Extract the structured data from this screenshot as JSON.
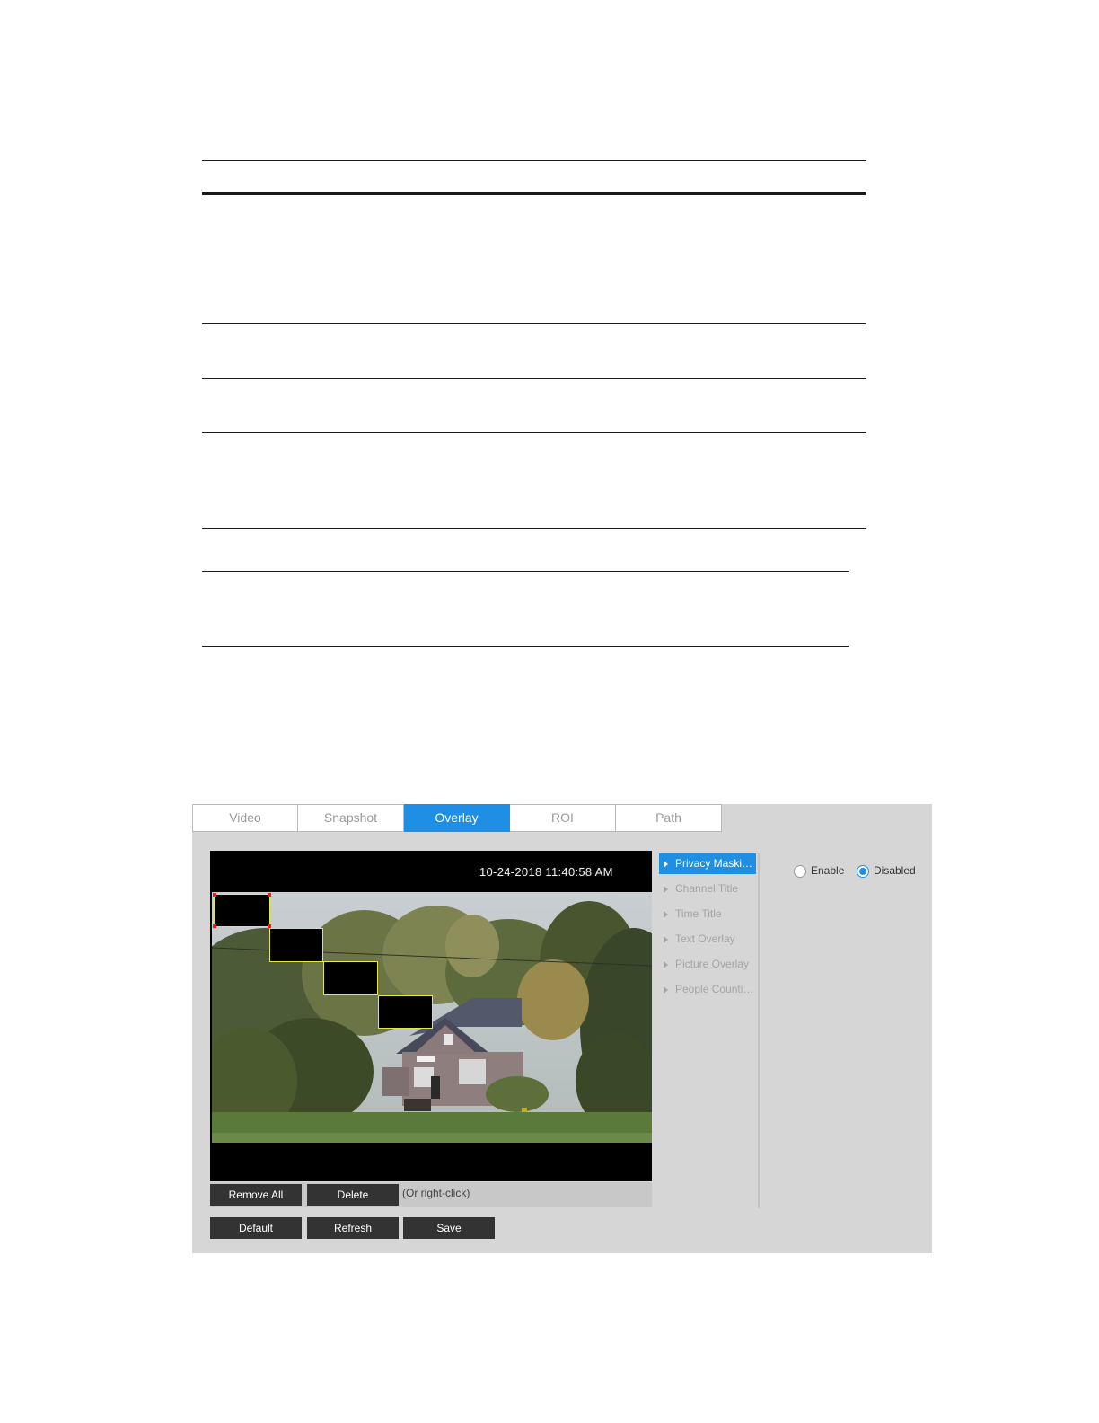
{
  "tabs": [
    {
      "label": "Video"
    },
    {
      "label": "Snapshot"
    },
    {
      "label": "Overlay"
    },
    {
      "label": "ROI"
    },
    {
      "label": "Path"
    }
  ],
  "active_tab": "Overlay",
  "video": {
    "osd_time": "10-24-2018 11:40:58 AM",
    "mask_count": 4
  },
  "edit_bar": {
    "remove_all_label": "Remove All",
    "delete_label": "Delete",
    "hint": "(Or right-click)"
  },
  "side_menu": {
    "items": [
      {
        "label": "Privacy Maski…"
      },
      {
        "label": "Channel Title"
      },
      {
        "label": "Time Title"
      },
      {
        "label": "Text Overlay"
      },
      {
        "label": "Picture Overlay"
      },
      {
        "label": "People Counti…"
      }
    ],
    "active": "Privacy Maski…"
  },
  "privacy_mask": {
    "enable_label": "Enable",
    "disabled_label": "Disabled",
    "selected": "Disabled"
  },
  "footer": {
    "default_label": "Default",
    "refresh_label": "Refresh",
    "save_label": "Save"
  },
  "colors": {
    "accent": "#1f8fe6",
    "panel_bg": "#d6d6d6",
    "button_bg": "#333333",
    "mask_border": "#e8e650"
  }
}
